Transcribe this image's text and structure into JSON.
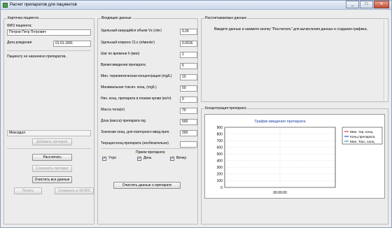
{
  "window": {
    "title": "Расчет препаратов для пациентов",
    "minimize": "_",
    "maximize": "□",
    "close": "✕"
  },
  "patient": {
    "legend": "Карточка пациента",
    "fio_label": "ФИО пациента:",
    "fio_value": "Петров Петр Петрович",
    "dob_label": "Дата рождения",
    "dob_value": "01.01.1991",
    "status": "Пациенту не назначено препаратов..",
    "drug_combo": "Мексидол",
    "add_drug_button": "Добавить препарат",
    "calc_button": "Рассчитать",
    "save_drug_button": "Сохранить препарат",
    "clear_button": "Очистить все данные",
    "print_button": "Печать",
    "save_word_button": "Сохранить в WORD"
  },
  "input": {
    "legend": "Входящие данные",
    "fields": [
      {
        "label": "Удельный кажущийся объем Vz (л/кг)",
        "value": "0.26"
      },
      {
        "label": "Удельный клиренс CLs (л/мин/кг)",
        "value": "0.0016"
      },
      {
        "label": "Шаг по времени h (мин)",
        "value": "1"
      },
      {
        "label": "Время введения препарата",
        "value": "5"
      },
      {
        "label": "Мин. терапевтическая концентрация (mg/L)",
        "value": "10"
      },
      {
        "label": "Минимальная токсич. конц. (mg/L)",
        "value": "50"
      },
      {
        "label": "Нач. конц. препарата в плазме крови (мг/л)",
        "value": "0"
      },
      {
        "label": "Масса тела(кг)",
        "value": "70"
      },
      {
        "label": "Доза (масса) препарата mg",
        "value": "500"
      },
      {
        "label": "Значение конц. для повторного введ.преп.",
        "value": "200"
      },
      {
        "label": "Текущая конц.препарата (необязательно)",
        "value": ""
      }
    ],
    "intake_label": "Прием препарата:",
    "intake": [
      {
        "label": "Утро",
        "checked": "✔"
      },
      {
        "label": "День",
        "checked": "✔"
      },
      {
        "label": "Вечер",
        "checked": "✔"
      }
    ],
    "clear_drug_button": "Очистить данные о препарате"
  },
  "results": {
    "legend": "Рассчитываемые данные",
    "message": "Введите данные и нажмите кнопку \"Рассчитать\" для вычисления данных и создания графика.."
  },
  "concentration": {
    "legend": "Концентрация препарата"
  },
  "chart_data": {
    "type": "line",
    "title": "График введения препарата",
    "xlabel": "",
    "ylabel": "",
    "x_ticks": [
      "00:00:00"
    ],
    "y_ticks": [
      0,
      100,
      200,
      300,
      400,
      500,
      600,
      700,
      800,
      900
    ],
    "ylim": [
      0,
      900
    ],
    "grid": true,
    "legend_position": "right",
    "series": [
      {
        "name": "Мин. тер. конц",
        "color": "#e03030",
        "values": []
      },
      {
        "name": "Конц препарата",
        "color": "#2050d0",
        "values": []
      },
      {
        "name": "Мин. Токс. конц",
        "color": "#20a0a0",
        "values": []
      }
    ]
  }
}
